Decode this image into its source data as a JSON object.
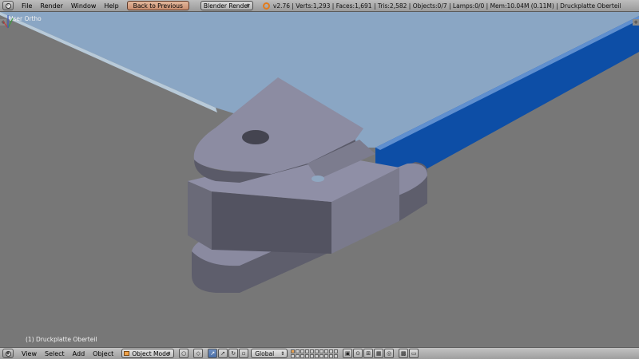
{
  "top_header": {
    "menus": [
      "File",
      "Render",
      "Window",
      "Help"
    ],
    "back_button": "Back to Previous",
    "render_engine": "Blender Render",
    "stats": "v2.76 | Verts:1,293 | Faces:1,691 | Tris:2,582 | Objects:0/7 | Lamps:0/0 | Mem:10.04M (0.11M) | Druckplatte Oberteil"
  },
  "viewport": {
    "view_label": "User Ortho",
    "object_label": "(1) Druckplatte Oberteil",
    "colors": {
      "background": "#777777",
      "plate": "#8aa6c4",
      "bar": "#0d4ea6",
      "model_face": "#5c5c6a"
    }
  },
  "bottom_header": {
    "menus": [
      "View",
      "Select",
      "Add",
      "Object"
    ],
    "mode": "Object Mode",
    "orientation": "Global",
    "icons": [
      "viewport-shading-icon",
      "pivot-icon",
      "manipulator-icon",
      "translate-icon",
      "rotate-icon",
      "scale-icon",
      "lock-icon",
      "snap-icon",
      "snap-target-icon",
      "render-icon",
      "camera-icon"
    ]
  }
}
